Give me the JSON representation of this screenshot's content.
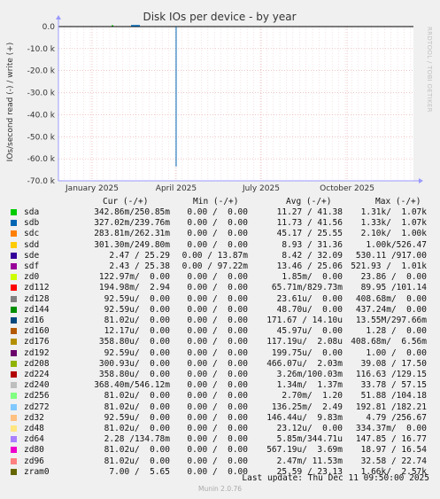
{
  "chart_data": {
    "type": "line",
    "title": "Disk IOs per device - by year",
    "ylabel": "IOs/second read (-) / write (+)",
    "side_label": "RRDTOOL / TOBI OETIKER",
    "y_ticks": [
      "0.0",
      "-10.0 k",
      "-20.0 k",
      "-30.0 k",
      "-40.0 k",
      "-50.0 k",
      "-60.0 k",
      "-70.0 k"
    ],
    "y_tick_values": [
      0,
      -10000,
      -20000,
      -30000,
      -40000,
      -50000,
      -60000,
      -70000
    ],
    "ylim": [
      -70000,
      0
    ],
    "x_ticks": [
      "January 2025",
      "April 2025",
      "July 2025",
      "October 2025"
    ],
    "x_range": [
      "2024-11-26",
      "2025-12-11"
    ],
    "x_tick_dates": [
      "2025-01-01",
      "2025-04-01",
      "2025-07-01",
      "2025-10-01"
    ],
    "spike": {
      "date": "2025-04-01",
      "value": -63500,
      "series": "sdb"
    },
    "grid": true,
    "legend_placement": "bottom"
  },
  "legend": {
    "headers": {
      "cur": "Cur (-/+)",
      "min": "Min (-/+)",
      "avg": "Avg (-/+)",
      "max": "Max (-/+)"
    },
    "rows": [
      {
        "name": "sda",
        "color": "#00cc00",
        "cur": "342.86m/250.85m",
        "min": "0.00 /  0.00",
        "avg": "11.27 / 41.38",
        "max": "1.31k/  1.07k"
      },
      {
        "name": "sdb",
        "color": "#0066b3",
        "cur": "327.02m/239.76m",
        "min": "0.00 /  0.00",
        "avg": "11.73 / 41.56",
        "max": "1.33k/  1.07k"
      },
      {
        "name": "sdc",
        "color": "#ff8000",
        "cur": "283.81m/262.31m",
        "min": "0.00 /  0.00",
        "avg": "45.17 / 25.55",
        "max": "2.10k/  1.00k"
      },
      {
        "name": "sdd",
        "color": "#ffcc00",
        "cur": "301.30m/249.80m",
        "min": "0.00 /  0.00",
        "avg": "8.93 / 31.36",
        "max": "1.00k/526.47"
      },
      {
        "name": "sde",
        "color": "#330099",
        "cur": "2.47 / 25.29",
        "min": "0.00 / 13.87m",
        "avg": "8.42 / 32.09",
        "max": "530.11 /917.00"
      },
      {
        "name": "sdf",
        "color": "#990099",
        "cur": "2.43 / 25.38",
        "min": "0.00 / 97.22m",
        "avg": "13.46 / 25.06",
        "max": "521.93 /  1.01k"
      },
      {
        "name": "zd0",
        "color": "#ccff00",
        "cur": "122.97m/  0.00",
        "min": "0.00 /  0.00",
        "avg": "1.85m/  0.00",
        "max": "23.86 /  0.00"
      },
      {
        "name": "zd112",
        "color": "#ff0000",
        "cur": "194.98m/  2.94",
        "min": "0.00 /  0.00",
        "avg": "65.71m/829.73m",
        "max": "89.95 /101.14"
      },
      {
        "name": "zd128",
        "color": "#808080",
        "cur": "92.59u/  0.00",
        "min": "0.00 /  0.00",
        "avg": "23.61u/  0.00",
        "max": "408.68m/  0.00"
      },
      {
        "name": "zd144",
        "color": "#008f00",
        "cur": "92.59u/  0.00",
        "min": "0.00 /  0.00",
        "avg": "48.70u/  0.00",
        "max": "437.24m/  0.00"
      },
      {
        "name": "zd16",
        "color": "#00487d",
        "cur": "81.02u/  0.00",
        "min": "0.00 /  0.00",
        "avg": "171.67 / 14.10u",
        "max": "13.55M/297.66m"
      },
      {
        "name": "zd160",
        "color": "#b35a00",
        "cur": "12.17u/  0.00",
        "min": "0.00 /  0.00",
        "avg": "45.97u/  0.00",
        "max": "1.28 /  0.00"
      },
      {
        "name": "zd176",
        "color": "#b38f00",
        "cur": "358.80u/  0.00",
        "min": "0.00 /  0.00",
        "avg": "117.19u/  2.08u",
        "max": "408.68m/  6.56m"
      },
      {
        "name": "zd192",
        "color": "#6b006b",
        "cur": "92.59u/  0.00",
        "min": "0.00 /  0.00",
        "avg": "199.75u/  0.00",
        "max": "1.00 /  0.00"
      },
      {
        "name": "zd208",
        "color": "#8fb300",
        "cur": "300.93u/  0.00",
        "min": "0.00 /  0.00",
        "avg": "466.07u/  2.03m",
        "max": "39.08 / 17.50"
      },
      {
        "name": "zd224",
        "color": "#b30000",
        "cur": "358.80u/  0.00",
        "min": "0.00 /  0.00",
        "avg": "3.26m/100.03m",
        "max": "116.63 /129.15"
      },
      {
        "name": "zd240",
        "color": "#bebebe",
        "cur": "368.40m/546.12m",
        "min": "0.00 /  0.00",
        "avg": "1.34m/  1.37m",
        "max": "33.78 / 57.15"
      },
      {
        "name": "zd256",
        "color": "#80ff80",
        "cur": "81.02u/  0.00",
        "min": "0.00 /  0.00",
        "avg": "2.70m/  1.20",
        "max": "51.88 /104.18"
      },
      {
        "name": "zd272",
        "color": "#80c9ff",
        "cur": "81.02u/  0.00",
        "min": "0.00 /  0.00",
        "avg": "136.25m/  2.49",
        "max": "192.81 /182.21"
      },
      {
        "name": "zd32",
        "color": "#ffc080",
        "cur": "92.59u/  0.00",
        "min": "0.00 /  0.00",
        "avg": "146.44u/  9.83m",
        "max": "4.79 /256.67"
      },
      {
        "name": "zd48",
        "color": "#ffe680",
        "cur": "81.02u/  0.00",
        "min": "0.00 /  0.00",
        "avg": "23.12u/  0.00",
        "max": "334.37m/  0.00"
      },
      {
        "name": "zd64",
        "color": "#aa80ff",
        "cur": "2.28 /134.78m",
        "min": "0.00 /  0.00",
        "avg": "5.85m/344.71u",
        "max": "147.85 / 16.77"
      },
      {
        "name": "zd80",
        "color": "#ee00cc",
        "cur": "81.02u/  0.00",
        "min": "0.00 /  0.00",
        "avg": "567.19u/  3.69m",
        "max": "18.97 / 16.54"
      },
      {
        "name": "zd96",
        "color": "#ff8080",
        "cur": "81.02u/  0.00",
        "min": "0.00 /  0.00",
        "avg": "2.47m/ 11.53m",
        "max": "32.58 / 22.74"
      },
      {
        "name": "zram0",
        "color": "#666600",
        "cur": "7.00 /  5.65",
        "min": "0.00 /  0.00",
        "avg": "25.59 / 23.13",
        "max": "1.66k/  2.57k"
      }
    ]
  },
  "last_update": "Last update: Thu Dec 11 09:50:00 2025",
  "footer": "Munin 2.0.76"
}
